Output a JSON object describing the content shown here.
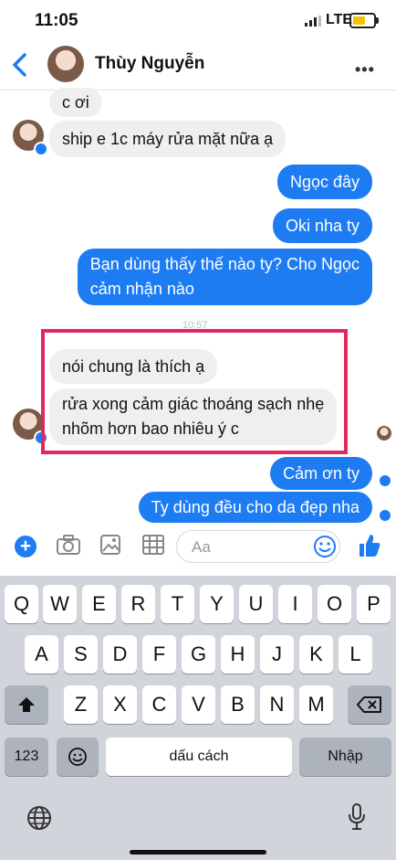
{
  "status_bar": {
    "time": "11:05",
    "network": "LTE"
  },
  "header": {
    "contact_name": "Thùy Nguyễn",
    "more": "•••"
  },
  "messages": [
    {
      "side": "in",
      "text": "c ơi"
    },
    {
      "side": "in",
      "text": "ship e 1c máy rửa mặt nữa ạ"
    },
    {
      "side": "out",
      "text": "Ngọc đây"
    },
    {
      "side": "out",
      "text": "Oki nha ty"
    },
    {
      "side": "out",
      "lines": [
        "Bạn dùng thấy thế nào ty? Cho Ngọc",
        "cảm nhận nào"
      ]
    },
    {
      "side": "in",
      "text": "nói chung là thích ạ"
    },
    {
      "side": "in",
      "lines": [
        "rửa xong cảm giác thoáng sạch nhẹ",
        "nhõm hơn bao nhiêu ý c"
      ]
    },
    {
      "side": "out",
      "text": "Cảm ơn ty"
    },
    {
      "side": "out",
      "text": "Ty dùng đều cho da đẹp nha"
    }
  ],
  "timestamp": "10:57",
  "composer": {
    "placeholder": "Aa"
  },
  "keyboard": {
    "row1": [
      "Q",
      "W",
      "E",
      "R",
      "T",
      "Y",
      "U",
      "I",
      "O",
      "P"
    ],
    "row2": [
      "A",
      "S",
      "D",
      "F",
      "G",
      "H",
      "J",
      "K",
      "L"
    ],
    "row3": [
      "Z",
      "X",
      "C",
      "V",
      "B",
      "N",
      "M"
    ],
    "numbers_key": "123",
    "space_key": "dấu cách",
    "return_key": "Nhập"
  },
  "colors": {
    "accent": "#1e7cf2",
    "highlight_box": "#e0285d"
  }
}
